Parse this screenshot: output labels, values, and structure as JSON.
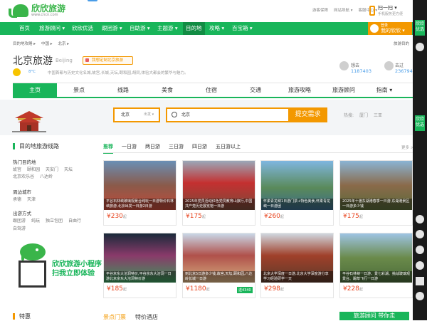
{
  "logo": {
    "name": "欣欣旅游",
    "url": "www.cncn.com"
  },
  "toplinks": [
    "游客保障",
    "网站导航 ▾",
    "客服中心 ▾"
  ],
  "scan": {
    "title": "扫一扫 ▾",
    "sub": "手机服务更方便"
  },
  "nav": {
    "items": [
      "首页",
      "旅游顾问 ▾",
      "欣欣优选",
      "跟团游 ▾",
      "自助游 ▾",
      "主题游 ▾",
      "目的地",
      "攻略 ▾",
      "百宝箱 ▾"
    ],
    "badge": "福利",
    "active_index": 6
  },
  "login": {
    "line1": "登录",
    "line2": "我的欣欣 ▾"
  },
  "breadcrumb": [
    "目的地攻略 ▸",
    "中国 ▸",
    "北京 ▸"
  ],
  "breadcrumb_right": "旅游目的",
  "city": {
    "name": "北京旅游",
    "en": "Beijing",
    "custom_btn": "我想定制北京旅游",
    "temp": "8°C",
    "desc": "中国首都与历史文化名城,故宫,长城,天坛,颐和园,胡同,体验大都会的繁华与魅力。"
  },
  "stats": [
    {
      "label": "想去",
      "value": "1187403"
    },
    {
      "label": "去过",
      "value": "2367940"
    }
  ],
  "tabs": [
    "主页",
    "景点",
    "线路",
    "美食",
    "住宿",
    "交通",
    "旅游攻略",
    "旅游顾问",
    "指南 ▾"
  ],
  "search": {
    "from": "北京",
    "from_sub": "出发 ▾",
    "query": "北京",
    "button": "提交需求",
    "hot_label": "热搜:",
    "hot": [
      "厦门",
      "三亚"
    ]
  },
  "sidebar": {
    "title": "目的地旅游线路",
    "groups": [
      {
        "title": "热门目的地",
        "links": [
          [
            "故宫",
            "颐和园",
            "天安门",
            "天坛"
          ],
          [
            "北京欢乐谷",
            "八达岭"
          ]
        ]
      },
      {
        "title": "周边城市",
        "links": [
          [
            "承德",
            "天津"
          ]
        ]
      },
      {
        "title": "出游方式",
        "links": [
          [
            "跟团游",
            "纯玩",
            "独立包团",
            "自由行"
          ],
          [
            "自驾游"
          ]
        ]
      }
    ],
    "miniprogram": {
      "line1": "欣欣旅游小程序",
      "line2": "扫我立即体验"
    }
  },
  "filters": [
    "推荐",
    "一日游",
    "两日游",
    "三日游",
    "四日游",
    "五日游以上"
  ],
  "more": "更多 >",
  "cards": [
    {
      "caption": "平谷石林峡玻璃观景台纯玩一日游特价石林峡旅游,北京出发一日游2日游",
      "price": "¥230",
      "unit": "起",
      "tag": ""
    },
    {
      "caption": "2025年党员活动红色党员教育山旅行,中国共产党历史展览馆一日游",
      "price": "¥175",
      "unit": "起",
      "tag": ""
    },
    {
      "caption": "怀柔青龙峡1日游门票+特色美食,怀柔青龙峡一日游团",
      "price": "¥260",
      "unit": "起",
      "tag": ""
    },
    {
      "caption": "2025年十渡东湖港春季一日游,东湖港景区一日游多少钱",
      "price": "¥175",
      "unit": "起",
      "tag": ""
    },
    {
      "caption": "平谷京东大溶洞特价,平谷京东大溶洞一日游北京京东大溶洞特价游",
      "price": "¥185",
      "unit": "起",
      "tag": ""
    },
    {
      "caption": "到北京5日游多少钱,故宫,天坛,颐和园,八达岭长城一日游",
      "price": "¥1180",
      "unit": "起",
      "tag": "送4340"
    },
    {
      "caption": "北京大学深度一日游,北京大学深度游分享学习经验研学一天",
      "price": "¥298",
      "unit": "起",
      "tag": ""
    },
    {
      "caption": "平谷石林峡一日游、景七彩湖、挑战玻璃观景台、踢草飞行一日游",
      "price": "¥228",
      "unit": "起",
      "tag": ""
    }
  ],
  "bottom": {
    "left": "特惠",
    "tab1": "景点门票",
    "tab2": "特价酒店",
    "banner": "旅游顾问 带你走"
  },
  "rightbar": {
    "btn1": "欣欣优选",
    "btn2": "欣欣优选"
  },
  "colors": {
    "brand": "#19b55a",
    "accent": "#f39800",
    "price": "#e8451f",
    "link": "#4a9de8"
  }
}
